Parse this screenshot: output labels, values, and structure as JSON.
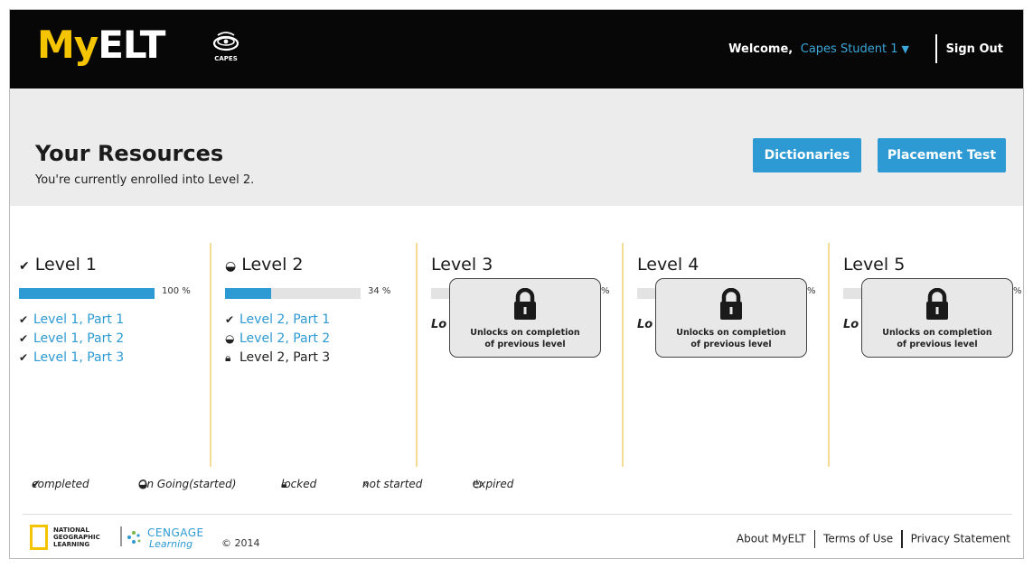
{
  "header": {
    "logo_my": "My",
    "logo_elt": "ELT",
    "partner_logo_text": "CAPES",
    "welcome_label": "Welcome,",
    "user_name": "Capes Student 1",
    "sign_out_label": "Sign Out"
  },
  "resources": {
    "title": "Your Resources",
    "subtitle": "You're currently enrolled into Level 2.",
    "dictionaries_label": "Dictionaries",
    "placement_test_label": "Placement Test"
  },
  "levels": [
    {
      "title": "Level 1",
      "status_icon": "check-icon",
      "progress_text": "100 %",
      "progress": 100,
      "parts": [
        {
          "label": "Level 1, Part 1",
          "status_icon": "check-icon",
          "link": true
        },
        {
          "label": "Level 1, Part 2",
          "status_icon": "check-icon",
          "link": true
        },
        {
          "label": "Level 1, Part 3",
          "status_icon": "check-icon",
          "link": true
        }
      ]
    },
    {
      "title": "Level 2",
      "status_icon": "half-circle-icon",
      "progress_text": "34 %",
      "progress": 34,
      "parts": [
        {
          "label": "Level 2, Part 1",
          "status_icon": "check-icon",
          "link": true
        },
        {
          "label": "Level 2, Part 2",
          "status_icon": "half-circle-icon",
          "link": true
        },
        {
          "label": "Level 2, Part 3",
          "status_icon": "lock-icon",
          "link": false
        }
      ]
    },
    {
      "title": "Level 3",
      "progress_text": "%",
      "hidden_text": "Lo",
      "lock_message_1": "Unlocks on completion",
      "lock_message_2": "of previous level"
    },
    {
      "title": "Level 4",
      "progress_text": "%",
      "hidden_text": "Lo",
      "lock_message_1": "Unlocks on completion",
      "lock_message_2": "of previous level"
    },
    {
      "title": "Level 5",
      "progress_text": "%",
      "hidden_text": "Lo",
      "lock_message_1": "Unlocks on completion",
      "lock_message_2": "of previous level"
    }
  ],
  "legend": {
    "completed": "completed",
    "ongoing": "On Going(started)",
    "locked": "locked",
    "not_started": "not started",
    "expired": "expired"
  },
  "footer": {
    "ng_logo_text": "NATIONAL\nGEOGRAPHIC\nLEARNING",
    "cengage_text": "CENGAGE",
    "cengage_sub": "Learning",
    "copyright": "© 2014",
    "about": "About MyELT",
    "terms": "Terms of Use",
    "privacy": "Privacy Statement"
  },
  "colors": {
    "accent": "#2e9ad3",
    "logo_yellow": "#f5c400",
    "column_divider": "#f3dd94"
  }
}
